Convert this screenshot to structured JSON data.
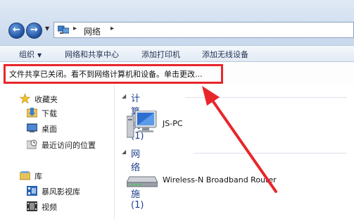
{
  "address": {
    "location": "网络"
  },
  "toolbar": {
    "organize": "组织",
    "network_center": "网络和共享中心",
    "add_printer": "添加打印机",
    "add_wireless": "添加无线设备"
  },
  "infobar": {
    "message": "文件共享已关闭。看不到网络计算机和设备。单击更改..."
  },
  "nav": {
    "favorites": "收藏夹",
    "downloads": "下载",
    "desktop": "桌面",
    "recent": "最近访问的位置",
    "libraries": "库",
    "storm_video": "暴风影视库",
    "videos": "视频"
  },
  "content": {
    "computers_header": "计算机 (1)",
    "computer_name": "JS-PC",
    "infra_header": "网络设施 (1)",
    "router_name": "Wireless-N Broadband Router"
  },
  "colors": {
    "highlight_red": "#e8262b",
    "group_blue": "#1e3f8a"
  }
}
